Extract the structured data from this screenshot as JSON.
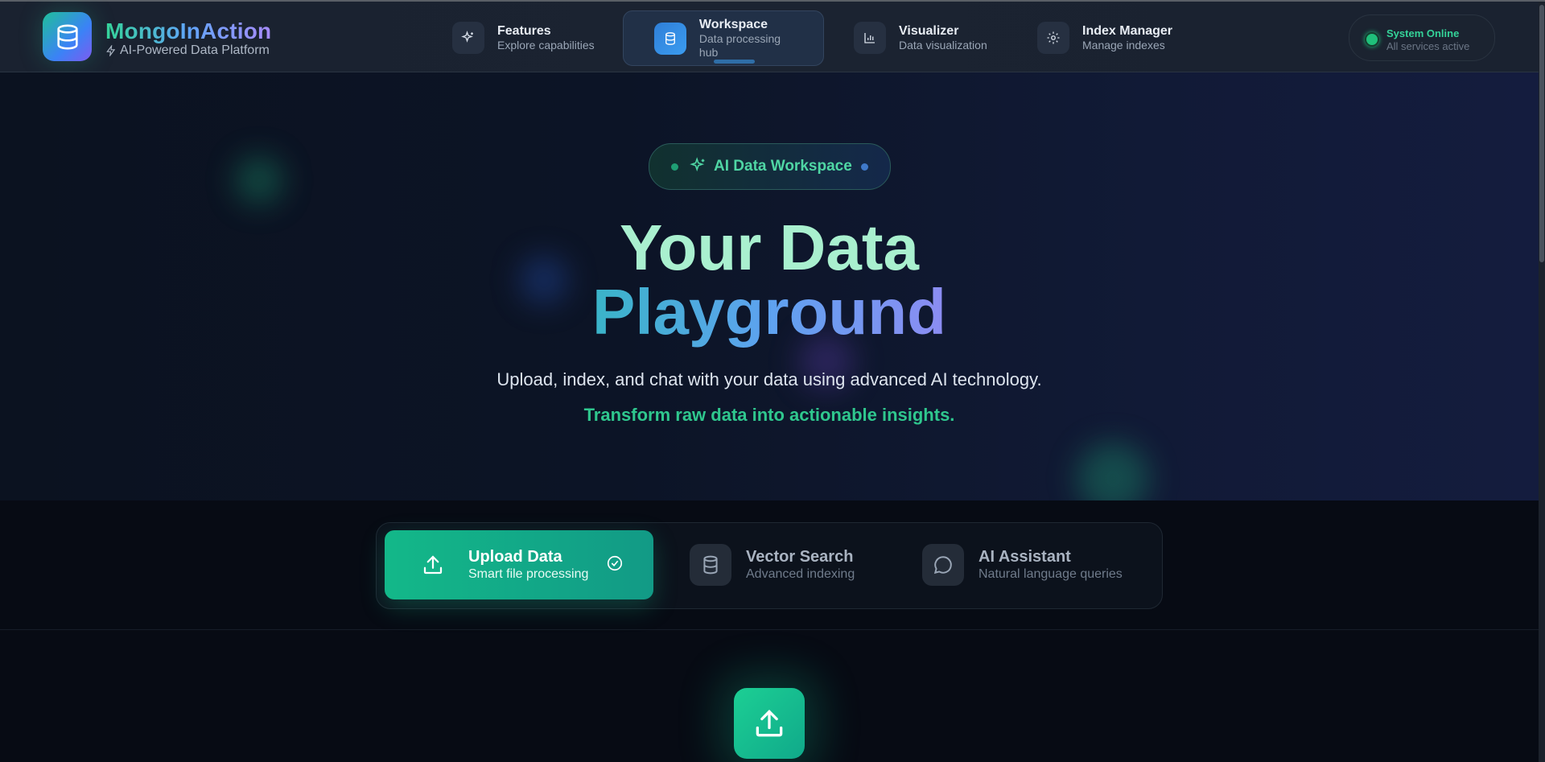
{
  "brand": {
    "title": "MongoInAction",
    "subtitle": "AI-Powered Data Platform",
    "logo_icon": "database-icon"
  },
  "nav": {
    "items": [
      {
        "title": "Features",
        "subtitle": "Explore capabilities",
        "icon": "sparkles-icon"
      },
      {
        "title": "Workspace",
        "subtitle": "Data processing hub",
        "icon": "database-icon",
        "active": true
      },
      {
        "title": "Visualizer",
        "subtitle": "Data visualization",
        "icon": "bar-chart-icon"
      },
      {
        "title": "Index Manager",
        "subtitle": "Manage indexes",
        "icon": "gear-icon"
      }
    ]
  },
  "status": {
    "title": "System Online",
    "subtitle": "All services active",
    "color": "#34d399"
  },
  "hero": {
    "badge": "AI Data Workspace",
    "headline_line1": "Your Data",
    "headline_line2": "Playground",
    "lead": "Upload, index, and chat with your data using advanced AI technology.",
    "tagline": "Transform raw data into actionable insights."
  },
  "tabs": [
    {
      "title": "Upload Data",
      "subtitle": "Smart file processing",
      "icon": "upload-icon",
      "active": true
    },
    {
      "title": "Vector Search",
      "subtitle": "Advanced indexing",
      "icon": "database-icon"
    },
    {
      "title": "AI Assistant",
      "subtitle": "Natural language queries",
      "icon": "chat-bubble-icon"
    }
  ],
  "colors": {
    "accent": "#13b889",
    "background": "#070b14",
    "nav": "#1a2230"
  }
}
